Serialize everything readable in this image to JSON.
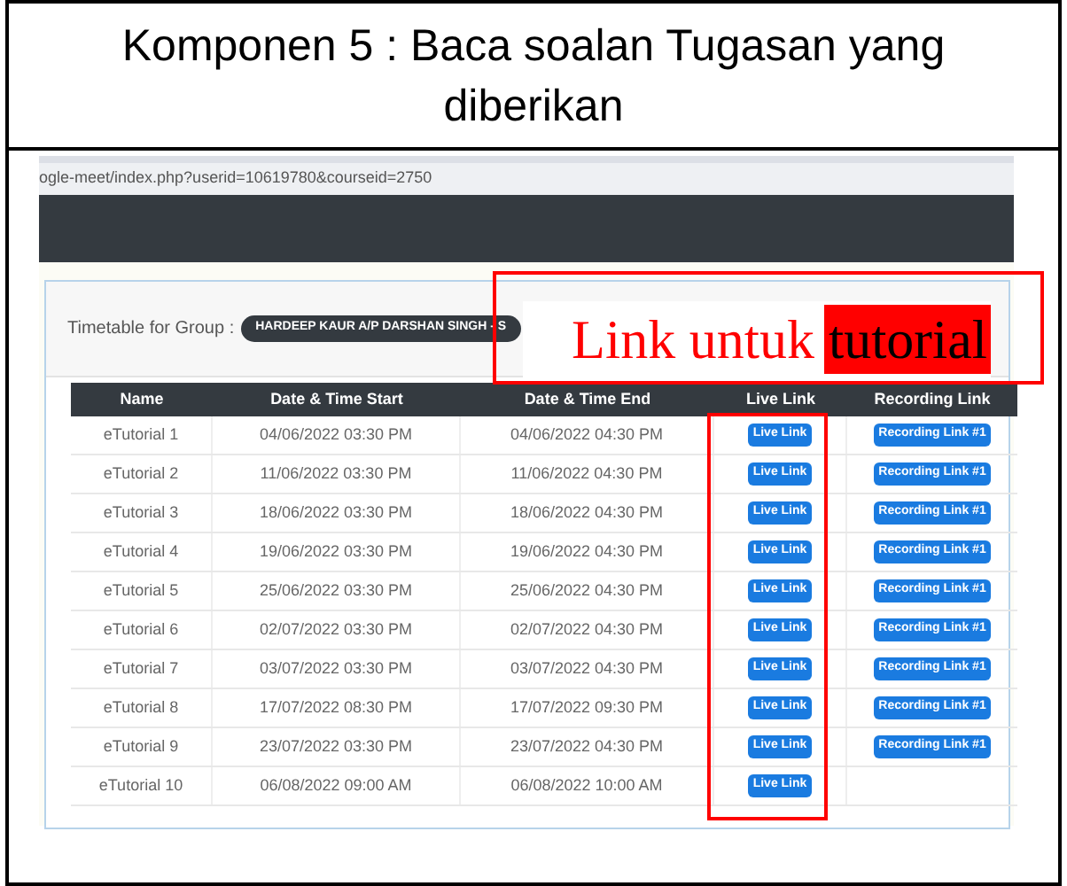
{
  "title": "Komponen 5 : Baca soalan Tugasan yang diberikan",
  "browser": {
    "url": "ogle-meet/index.php?userid=10619780&courseid=2750"
  },
  "card": {
    "label": "Timetable for Group :",
    "group_badge": "HARDEEP KAUR A/P DARSHAN SINGH - S"
  },
  "table": {
    "columns": [
      "Name",
      "Date & Time Start",
      "Date & Time End",
      "Live Link",
      "Recording Link"
    ],
    "rows": [
      {
        "name": "eTutorial 1",
        "start": "04/06/2022 03:30 PM",
        "end": "04/06/2022 04:30 PM",
        "live_link": "Live Link",
        "recording_link": "Recording Link #1"
      },
      {
        "name": "eTutorial 2",
        "start": "11/06/2022 03:30 PM",
        "end": "11/06/2022 04:30 PM",
        "live_link": "Live Link",
        "recording_link": "Recording Link #1"
      },
      {
        "name": "eTutorial 3",
        "start": "18/06/2022 03:30 PM",
        "end": "18/06/2022 04:30 PM",
        "live_link": "Live Link",
        "recording_link": "Recording Link #1"
      },
      {
        "name": "eTutorial 4",
        "start": "19/06/2022 03:30 PM",
        "end": "19/06/2022 04:30 PM",
        "live_link": "Live Link",
        "recording_link": "Recording Link #1"
      },
      {
        "name": "eTutorial 5",
        "start": "25/06/2022 03:30 PM",
        "end": "25/06/2022 04:30 PM",
        "live_link": "Live Link",
        "recording_link": "Recording Link #1"
      },
      {
        "name": "eTutorial 6",
        "start": "02/07/2022 03:30 PM",
        "end": "02/07/2022 04:30 PM",
        "live_link": "Live Link",
        "recording_link": "Recording Link #1"
      },
      {
        "name": "eTutorial 7",
        "start": "03/07/2022 03:30 PM",
        "end": "03/07/2022 04:30 PM",
        "live_link": "Live Link",
        "recording_link": "Recording Link #1"
      },
      {
        "name": "eTutorial 8",
        "start": "17/07/2022 08:30 PM",
        "end": "17/07/2022 09:30 PM",
        "live_link": "Live Link",
        "recording_link": "Recording Link #1"
      },
      {
        "name": "eTutorial 9",
        "start": "23/07/2022 03:30 PM",
        "end": "23/07/2022 04:30 PM",
        "live_link": "Live Link",
        "recording_link": "Recording Link #1"
      },
      {
        "name": "eTutorial 10",
        "start": "06/08/2022 09:00 AM",
        "end": "06/08/2022 10:00 AM",
        "live_link": "Live Link"
      }
    ]
  },
  "callout": {
    "text": "Link untuk",
    "highlighted_text": "tutorial"
  }
}
